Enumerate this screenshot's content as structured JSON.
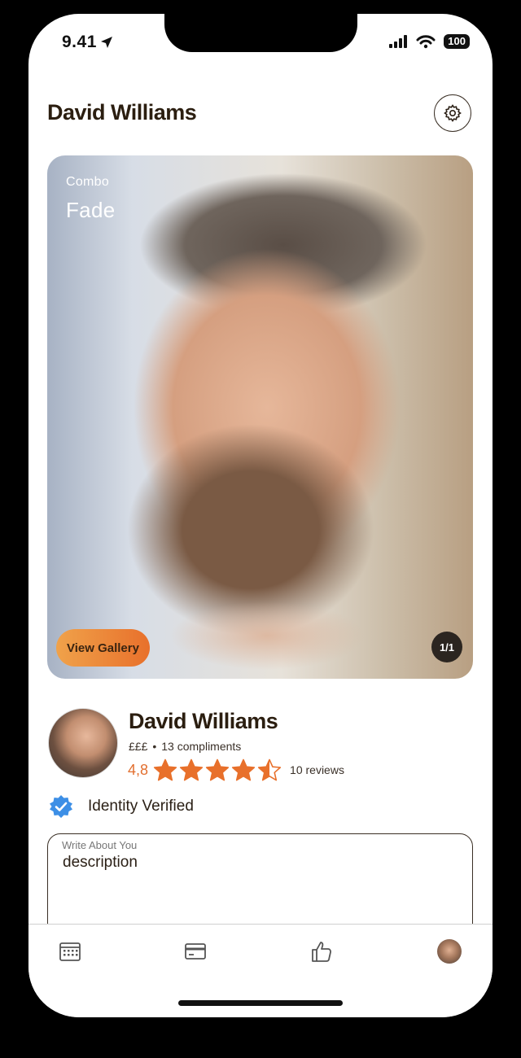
{
  "status_bar": {
    "time": "9.41",
    "battery": "100"
  },
  "header": {
    "title": "David Williams"
  },
  "hero": {
    "category": "Combo",
    "style": "Fade",
    "gallery_button": "View Gallery",
    "counter": "1/1"
  },
  "profile": {
    "name": "David Williams",
    "price_level": "£££",
    "separator": "•",
    "compliments": "13 compliments",
    "rating": "4,8",
    "rating_value": 4.5,
    "reviews": "10 reviews",
    "verified_label": "Identity Verified"
  },
  "description": {
    "label": "Write About You",
    "value": "description"
  },
  "tabs": [
    {
      "icon": "calendar-icon"
    },
    {
      "icon": "card-icon"
    },
    {
      "icon": "thumbs-up-icon"
    },
    {
      "icon": "profile-avatar"
    }
  ],
  "colors": {
    "accent": "#e8702b",
    "verified": "#3d8fe6",
    "title": "#2b1e10"
  }
}
